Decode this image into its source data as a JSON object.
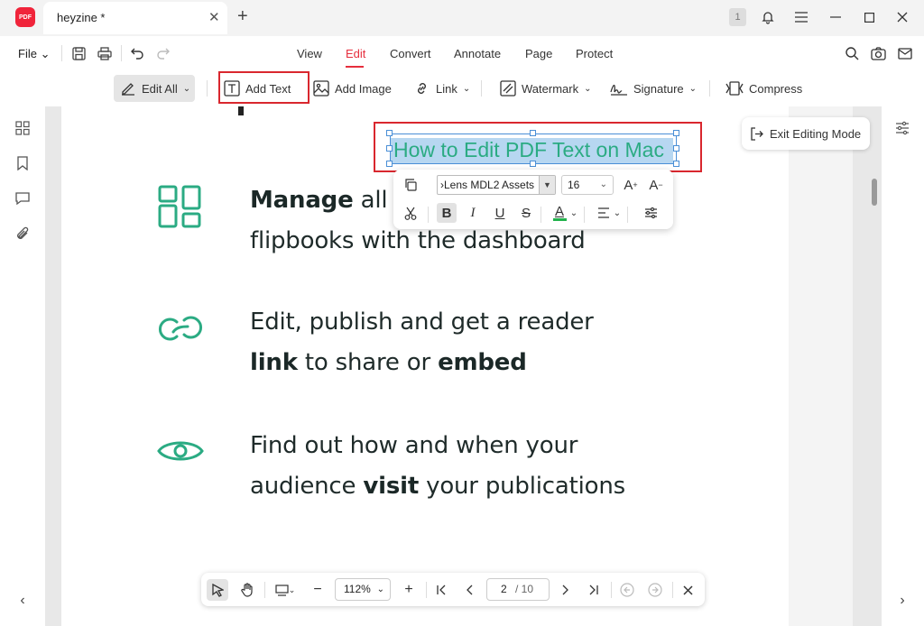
{
  "app": {
    "logo_text": "PDF"
  },
  "tab": {
    "title": "heyzine *"
  },
  "window": {
    "badge": "1"
  },
  "menu": {
    "file": "File",
    "tabs": [
      "View",
      "Edit",
      "Convert",
      "Annotate",
      "Page",
      "Protect"
    ],
    "active_tab": "Edit"
  },
  "toolbar": {
    "edit_all": "Edit All",
    "add_text": "Add Text",
    "add_image": "Add Image",
    "link": "Link",
    "watermark": "Watermark",
    "signature": "Signature",
    "compress": "Compress"
  },
  "document": {
    "heading": "How to Edit PDF Text on Mac",
    "features": [
      {
        "icon": "dashboard-icon",
        "bold": "Manage",
        "rest1": " all y",
        "line2": "flipbooks with the dashboard"
      },
      {
        "icon": "link-icon",
        "line1": "Edit, publish and get a reader",
        "bold_a": "link",
        "mid": " to share or ",
        "bold_b": "embed"
      },
      {
        "icon": "eye-icon",
        "line1": "Find out how and when your",
        "pre": "audience ",
        "bold": "visit",
        "post": " your publications"
      }
    ],
    "accent_color": "#2bab83"
  },
  "exit_editing": "Exit Editing Mode",
  "format": {
    "font": "›Lens MDL2 Assets",
    "size": "16",
    "text_color": "#22b24c"
  },
  "bottom": {
    "zoom": "112%",
    "page_current": "2",
    "page_total": "/ 10"
  }
}
